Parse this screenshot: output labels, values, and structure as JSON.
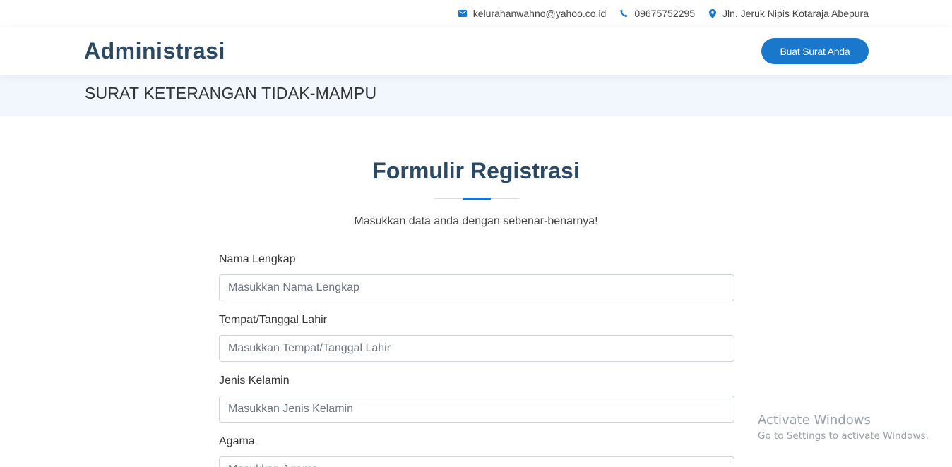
{
  "topbar": {
    "email": "kelurahanwahno@yahoo.co.id",
    "phone": "09675752295",
    "address": "Jln. Jeruk Nipis Kotaraja Abepura",
    "icons": [
      "envelope-icon",
      "phone-icon",
      "map-marker-icon"
    ]
  },
  "header": {
    "logo": "Administrasi",
    "cta_label": "Buat Surat Anda"
  },
  "breadcrumb": {
    "title": "SURAT KETERANGAN TIDAK-MAMPU"
  },
  "form": {
    "title": "Formulir Registrasi",
    "subtitle": "Masukkan data anda dengan sebenar-benarnya!",
    "fields": [
      {
        "label": "Nama Lengkap",
        "placeholder": "Masukkan Nama Lengkap",
        "value": ""
      },
      {
        "label": "Tempat/Tanggal Lahir",
        "placeholder": "Masukkan Tempat/Tanggal Lahir",
        "value": ""
      },
      {
        "label": "Jenis Kelamin",
        "placeholder": "Masukkan Jenis Kelamin",
        "value": ""
      },
      {
        "label": "Agama",
        "placeholder": "Masukkan Agama",
        "value": ""
      }
    ]
  },
  "watermark": {
    "title": "Activate Windows",
    "subtitle": "Go to Settings to activate Windows."
  },
  "colors": {
    "brand": "#1977cc",
    "heading": "#2c4964",
    "band": "#f1f7fd"
  }
}
